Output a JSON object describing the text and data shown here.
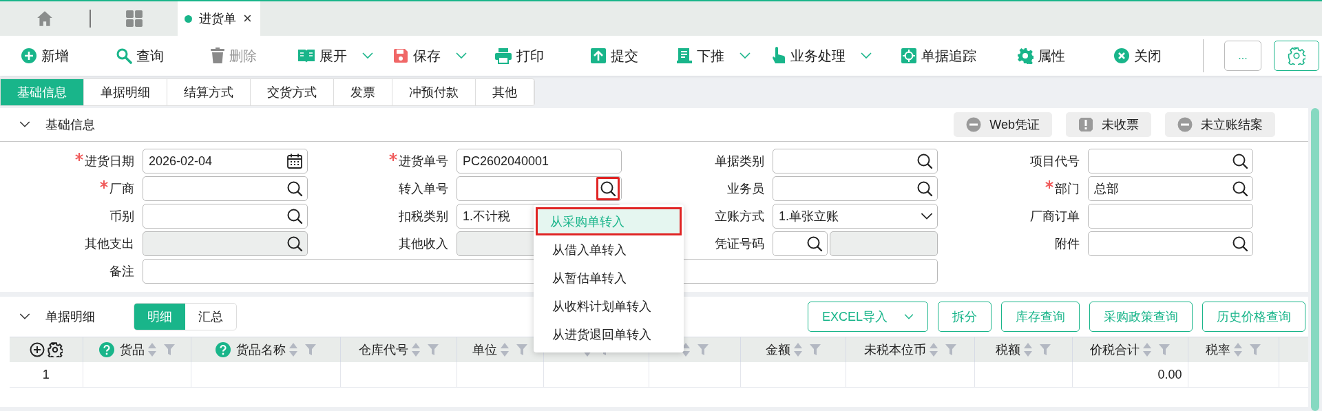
{
  "open_tabs": [
    {
      "label": "进货单",
      "close": "×",
      "selected": true
    }
  ],
  "toolbar": {
    "buttons": [
      {
        "label": "新增",
        "disabled": false,
        "dropdown": false
      },
      {
        "label": "查询",
        "disabled": false,
        "dropdown": false
      },
      {
        "label": "删除",
        "disabled": true,
        "dropdown": false
      },
      {
        "label": "展开",
        "disabled": false,
        "dropdown": true
      },
      {
        "label": "保存",
        "disabled": false,
        "dropdown": true
      },
      {
        "label": "打印",
        "disabled": false,
        "dropdown": false
      },
      {
        "label": "提交",
        "disabled": false,
        "dropdown": false
      },
      {
        "label": "下推",
        "disabled": false,
        "dropdown": true
      },
      {
        "label": "业务处理",
        "disabled": false,
        "dropdown": true
      },
      {
        "label": "单据追踪",
        "disabled": false,
        "dropdown": false
      },
      {
        "label": "属性",
        "disabled": false,
        "dropdown": false
      },
      {
        "label": "关闭",
        "disabled": false,
        "dropdown": false
      }
    ],
    "more_button": "..."
  },
  "form_tabs": [
    {
      "label": "基础信息",
      "selected": true
    },
    {
      "label": "单据明细",
      "selected": false
    },
    {
      "label": "结算方式",
      "selected": false
    },
    {
      "label": "交货方式",
      "selected": false
    },
    {
      "label": "发票",
      "selected": false
    },
    {
      "label": "冲预付款",
      "selected": false
    },
    {
      "label": "其他",
      "selected": false
    }
  ],
  "basic_section": {
    "title": "基础信息",
    "expanded": true,
    "status_badges": [
      {
        "label": "Web凭证",
        "kind": "minus"
      },
      {
        "label": "未收票",
        "kind": "alert"
      },
      {
        "label": "未立账结案",
        "kind": "minus"
      }
    ],
    "fields": [
      {
        "label": "进货日期",
        "required": true,
        "kind": "date",
        "value": "2026-02-04"
      },
      {
        "label": "进货单号",
        "required": true,
        "kind": "text",
        "value": "PC2602040001"
      },
      {
        "label": "单据类别",
        "required": false,
        "kind": "lookup"
      },
      {
        "label": "项目代号",
        "required": false,
        "kind": "lookup"
      },
      {
        "label": "厂商",
        "required": true,
        "kind": "lookup"
      },
      {
        "label": "转入单号",
        "required": false,
        "kind": "lookup",
        "highlighted": true
      },
      {
        "label": "业务员",
        "required": false,
        "kind": "lookup"
      },
      {
        "label": "部门",
        "required": true,
        "kind": "lookup",
        "value": "总部"
      },
      {
        "label": "币别",
        "required": false,
        "kind": "lookup"
      },
      {
        "label": "扣税类别",
        "required": false,
        "kind": "text",
        "value": "1.不计税"
      },
      {
        "label": "立账方式",
        "required": false,
        "kind": "select",
        "value": "1.单张立账"
      },
      {
        "label": "厂商订单",
        "required": false,
        "kind": "text"
      },
      {
        "label": "其他支出",
        "required": false,
        "kind": "lookup",
        "disabled": true
      },
      {
        "label": "其他收入",
        "required": false,
        "kind": "text",
        "disabled": true
      },
      {
        "label": "凭证号码",
        "required": false,
        "kind": "split"
      },
      {
        "label": "附件",
        "required": false,
        "kind": "lookup"
      },
      {
        "label": "备注",
        "required": false,
        "kind": "memo"
      }
    ]
  },
  "transfer_menu": {
    "items": [
      {
        "label": "从采购单转入",
        "selected": true
      },
      {
        "label": "从借入单转入",
        "selected": false
      },
      {
        "label": "从暂估单转入",
        "selected": false
      },
      {
        "label": "从收料计划单转入",
        "selected": false
      },
      {
        "label": "从进货退回单转入",
        "selected": false
      }
    ]
  },
  "detail_section": {
    "title": "单据明细",
    "expanded": true,
    "view_tabs": [
      {
        "label": "明细",
        "selected": true
      },
      {
        "label": "汇总",
        "selected": false
      }
    ],
    "buttons": [
      {
        "label": "EXCEL导入",
        "dropdown": true
      },
      {
        "label": "拆分",
        "dropdown": false
      },
      {
        "label": "库存查询",
        "dropdown": false
      },
      {
        "label": "采购政策查询",
        "dropdown": false
      },
      {
        "label": "历史价格查询",
        "dropdown": false
      }
    ],
    "table": {
      "columns": [
        {
          "label": "货品",
          "help": true
        },
        {
          "label": "货品名称",
          "help": true
        },
        {
          "label": "仓库代号",
          "help": false
        },
        {
          "label": "单位",
          "help": false
        },
        {
          "help": false
        },
        {
          "help": false
        },
        {
          "label": "金额",
          "help": false
        },
        {
          "label": "未税本位币",
          "help": false
        },
        {
          "label": "税额",
          "help": false
        },
        {
          "label": "价税合计",
          "help": false
        },
        {
          "label": "税率",
          "help": false
        }
      ],
      "rows": [
        {
          "number": "1",
          "cells": [
            null,
            null,
            null,
            null,
            null,
            null,
            null,
            null,
            null,
            "0.00",
            null
          ]
        }
      ]
    }
  }
}
